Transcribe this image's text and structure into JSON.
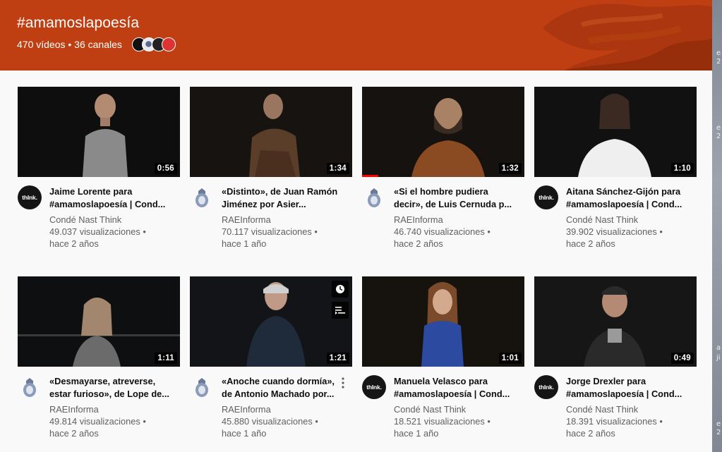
{
  "header": {
    "hashtag": "#amamoslapoesía",
    "meta": "470 vídeos • 36 canales",
    "channel_icons": [
      "think-logo-icon",
      "rae-crest-icon",
      "channel-logo-icon",
      "channel-logo-icon"
    ]
  },
  "colors": {
    "banner": "#bf3f12",
    "progress": "#ff0000"
  },
  "edge_text": [
    "e",
    "2",
    "e",
    "2",
    "a",
    "ji",
    "e",
    "2"
  ],
  "videos": [
    {
      "title1": "Jaime Lorente para",
      "title2": "#amamoslapoesía | Cond...",
      "channel": "Condé Nast Think",
      "views": "49.037 visualizaciones •",
      "age": "hace 2 años",
      "duration": "0:56",
      "avatar": "thInk."
    },
    {
      "title1": "«Distinto», de Juan Ramón",
      "title2": "Jiménez por Asier...",
      "channel": "RAEInforma",
      "views": "70.117 visualizaciones •",
      "age": "hace 1 año",
      "duration": "1:34",
      "avatar": "rae-crest-icon"
    },
    {
      "title1": "«Si el hombre pudiera",
      "title2": "decir», de Luis Cernuda p...",
      "channel": "RAEInforma",
      "views": "46.740 visualizaciones •",
      "age": "hace 2 años",
      "duration": "1:32",
      "avatar": "rae-crest-icon",
      "watched_fraction": 0.1
    },
    {
      "title1": "Aitana Sánchez-Gijón para",
      "title2": "#amamoslapoesía | Cond...",
      "channel": "Condé Nast Think",
      "views": "39.902 visualizaciones •",
      "age": "hace 2 años",
      "duration": "1:10",
      "avatar": "thInk."
    },
    {
      "title1": "«Desmayarse, atreverse,",
      "title2": "estar furioso», de Lope de...",
      "channel": "RAEInforma",
      "views": "49.814 visualizaciones •",
      "age": "hace 2 años",
      "duration": "1:11",
      "avatar": "rae-crest-icon"
    },
    {
      "title1": "«Anoche cuando dormía»,",
      "title2": "de Antonio Machado por...",
      "channel": "RAEInforma",
      "views": "45.880 visualizaciones •",
      "age": "hace 1 año",
      "duration": "1:21",
      "avatar": "rae-crest-icon",
      "hovered": true
    },
    {
      "title1": "Manuela Velasco para",
      "title2": "#amamoslapoesía | Cond...",
      "channel": "Condé Nast Think",
      "views": "18.521 visualizaciones •",
      "age": "hace 1 año",
      "duration": "1:01",
      "avatar": "thInk."
    },
    {
      "title1": "Jorge Drexler para",
      "title2": "#amamoslapoesía | Cond...",
      "channel": "Condé Nast Think",
      "views": "18.391 visualizaciones •",
      "age": "hace 2 años",
      "duration": "0:49",
      "avatar": "thInk."
    }
  ]
}
